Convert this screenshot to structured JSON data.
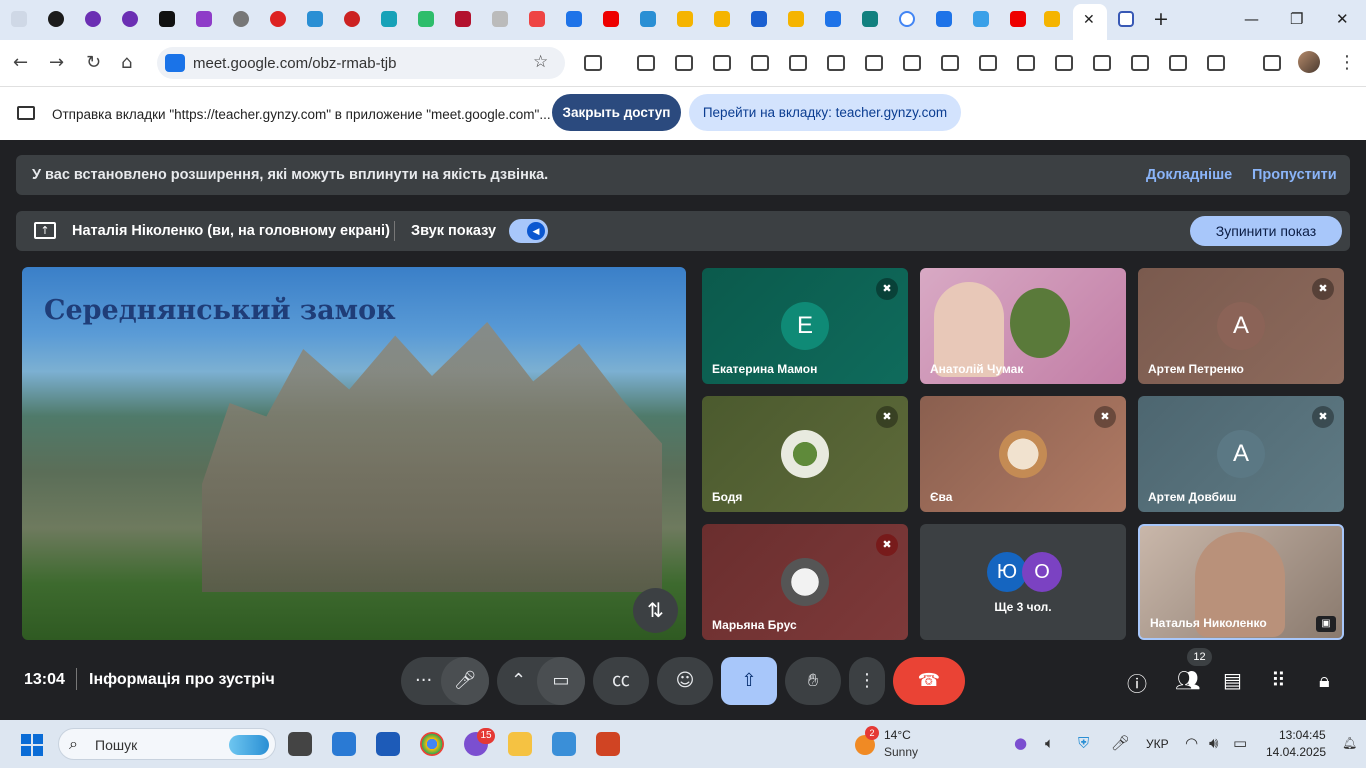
{
  "browser": {
    "url": "meet.google.com/obz-rmab-tjb",
    "sharing_notice": "Отправка вкладки \"https://teacher.gynzy.com\" в приложение \"meet.google.com\"...",
    "stop_access_label": "Закрыть доступ",
    "goto_tab_label": "Перейти на вкладку: teacher.gynzy.com"
  },
  "meet": {
    "extension_banner": {
      "message": "У вас встановлено розширення, які можуть вплинути на якість дзвінка.",
      "more_label": "Докладніше",
      "skip_label": "Пропустити"
    },
    "presenting": {
      "presenter": "Наталія Ніколенко (ви, на головному екрані)",
      "sound_label": "Звук показу",
      "stop_label": "Зупинити показ"
    },
    "shared_slide_title": "Середнянський замок",
    "participants": [
      {
        "name": "Екатерина Мамон",
        "initial": "Е",
        "muted": true
      },
      {
        "name": "Анатолій Чумак",
        "initial": "",
        "muted": false
      },
      {
        "name": "Артем Петренко",
        "initial": "А",
        "muted": true
      },
      {
        "name": "Бодя",
        "initial": "",
        "muted": true
      },
      {
        "name": "Єва",
        "initial": "",
        "muted": true
      },
      {
        "name": "Артем Довбиш",
        "initial": "А",
        "muted": true
      },
      {
        "name": "Марьяна Брус",
        "initial": "",
        "muted": true
      },
      {
        "name": "Ще 3 чол.",
        "initial": "",
        "muted": false
      },
      {
        "name": "Наталья Николенко",
        "initial": "",
        "muted": false
      }
    ],
    "more_avatars": [
      "Ю",
      "О"
    ],
    "time": "13:04",
    "meeting_info_label": "Інформація про зустріч",
    "people_count": "12"
  },
  "taskbar": {
    "search_placeholder": "Пошук",
    "weather_temp": "14°C",
    "weather_condition": "Sunny",
    "weather_badge": "2",
    "viber_badge": "15",
    "language": "УКР",
    "time": "13:04:45",
    "date": "14.04.2025"
  },
  "colors": {
    "meet_bg": "#202124",
    "end_call": "#ea4335",
    "accent_blue": "#a8c7fa"
  }
}
